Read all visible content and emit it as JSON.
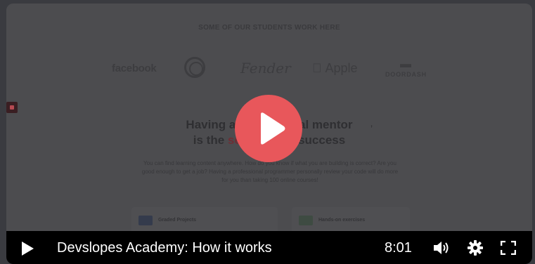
{
  "video": {
    "students_title": "SOME OF OUR STUDENTS WORK HERE",
    "logos": {
      "facebook": "facebook",
      "fender": "Fender",
      "apple": "Apple",
      "doordash": "DOORDASH"
    },
    "headline_line1": "Having a",
    "headline_line1_end": "al mentor",
    "headline_line2_start": "is the",
    "headline_accent": "sec",
    "headline_line2_end": "o success",
    "description": "You can find learning content anywhere. How do you know if what you are building is correct? Are you good enough to get a job? Having a professional programmer personally review your code will do more for you than taking 100 online courses!",
    "card_1_title": "Graded Projects",
    "card_2_title": "Hands-on exercises"
  },
  "controls": {
    "title": "Devslopes Academy: How it works",
    "time": "8:01"
  },
  "colors": {
    "play_accent": "#e8575b",
    "control_bar": "#000000"
  },
  "icons": [
    "play-icon",
    "volume-icon",
    "settings-icon",
    "fullscreen-icon"
  ]
}
